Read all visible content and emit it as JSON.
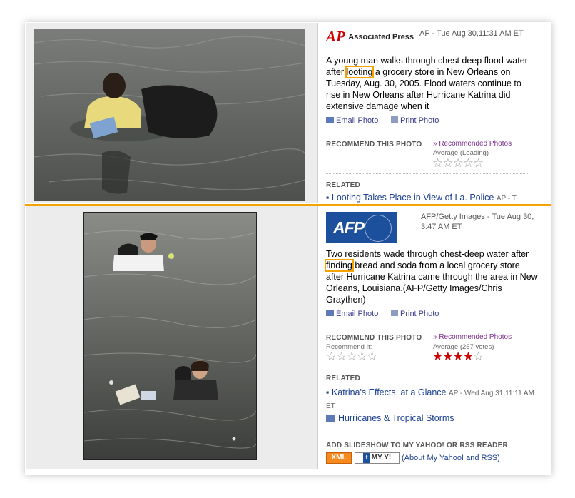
{
  "top": {
    "logo_text": "Associated Press",
    "source": "AP - Tue Aug 30,11:31 AM ET",
    "caption_before": "A young man walks through chest deep flood water after ",
    "caption_highlight": "looting",
    "caption_after": " a grocery store in New Orleans on Tuesday, Aug. 30, 2005. Flood waters continue to rise in New Orleans after Hurricane Katrina did extensive damage when it",
    "email_label": "Email Photo",
    "print_label": "Print Photo",
    "recommend_heading": "RECOMMEND THIS PHOTO",
    "recommended_link": "» Recommended Photos",
    "average_label": "Average (Loading)",
    "average_stars": "☆☆☆☆☆",
    "related_heading": "RELATED",
    "related_link": "Looting Takes Place in View of La. Police",
    "related_meta": "AP - Ti"
  },
  "bottom": {
    "logo_text": "AFP",
    "source": "AFP/Getty Images - Tue Aug 30, 3:47 AM ET",
    "caption_highlight": "finding",
    "caption_before": "Two residents wade through chest-deep water after ",
    "caption_after": " bread and soda from a local grocery store after Hurricane Katrina came through the area in New Orleans, Louisiana.(AFP/Getty Images/Chris Graythen)",
    "email_label": "Email Photo",
    "print_label": "Print Photo",
    "recommend_heading": "RECOMMEND THIS PHOTO",
    "recommended_link": "» Recommended Photos",
    "recommend_it_label": "Recommend It:",
    "recommend_it_stars": "☆☆☆☆☆",
    "average_label": "Average (257 votes)",
    "average_rating": 4.5,
    "related_heading": "RELATED",
    "related_1_link": "Katrina's Effects, at a Glance",
    "related_1_meta": "AP - Wed Aug 31,11:11 AM ET",
    "related_2_link": "Hurricanes & Tropical Storms",
    "slideshow_heading": "ADD SLIDESHOW TO MY YAHOO! OR RSS READER",
    "xml_label": "XML",
    "myyahoo_label": "MY Y!",
    "about_link": "(About My Yahoo! and RSS)"
  },
  "colors": {
    "highlight": "#f5a300",
    "link": "#1a3f8f",
    "afp_blue": "#1c4f9c",
    "ap_red": "#cc0000",
    "star_red": "#cc0000"
  }
}
